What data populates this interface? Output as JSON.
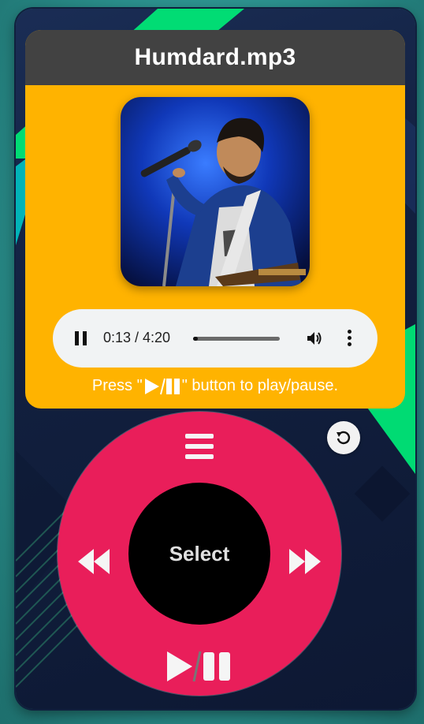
{
  "header": {
    "title": "Humdard.mp3"
  },
  "album_art": {
    "subject": "singer-with-microphone-photo"
  },
  "audio_player": {
    "time_display": "0:13 / 4:20",
    "progress": 0.05,
    "state": "playing",
    "icons": {
      "pause": "pause-icon",
      "volume": "volume-icon",
      "more": "more-options-icon"
    }
  },
  "hint": {
    "prefix": "Press \"",
    "suffix": "\" button to play/pause."
  },
  "reset": {
    "icon": "reset-icon"
  },
  "wheel": {
    "select_label": "Select",
    "icons": {
      "top": "menu-icon",
      "left": "rewind-icon",
      "right": "fast-forward-icon",
      "bottom": "play-pause-icon"
    }
  },
  "colors": {
    "screen_bg": "#ffb300",
    "title_bar": "#424242",
    "wheel": "#e91e5a",
    "select_center": "#000000",
    "player_bg": "#f1f3f4",
    "accent_green": "#00e676"
  }
}
